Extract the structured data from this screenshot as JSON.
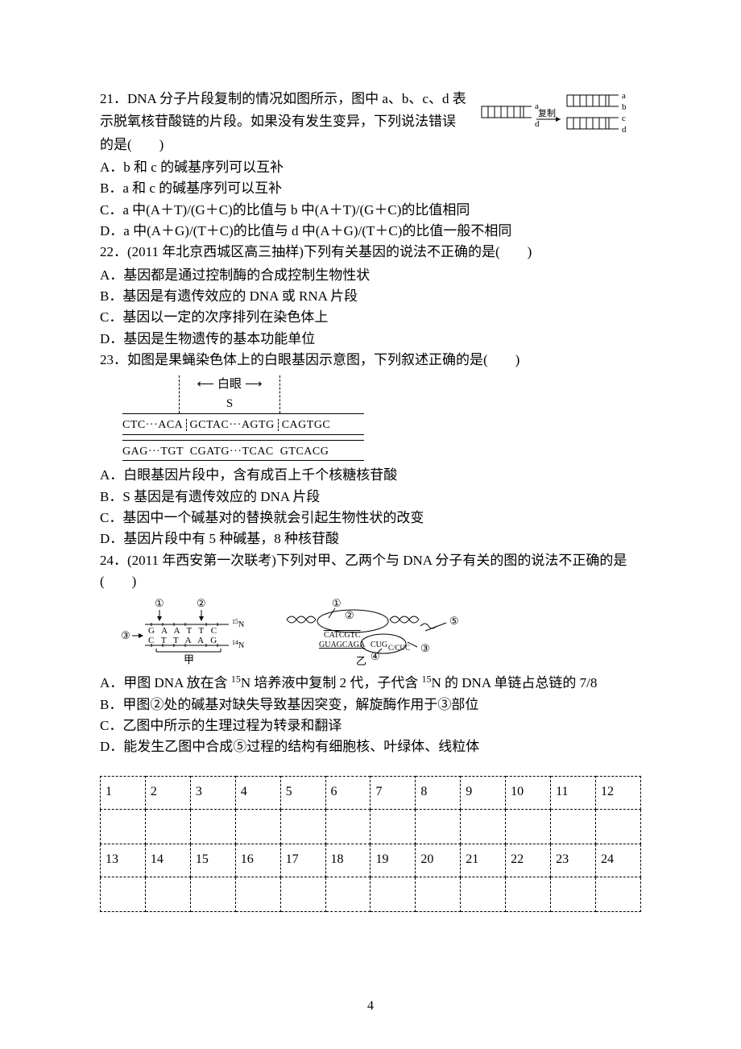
{
  "q21": {
    "stem1": "21．DNA 分子片段复制的情况如图所示，图中 a、b、c、d 表",
    "stem2": "示脱氧核苷酸链的片段。如果没有发生变异，下列说法错误",
    "stem3": "的是(　　)",
    "optA": "A．b 和 c 的碱基序列可以互补",
    "optB": "B．a 和 c 的碱基序列可以互补",
    "optC": "C．a 中(A＋T)/(G＋C)的比值与 b 中(A＋T)/(G＋C)的比值相同",
    "optD": "D．a 中(A＋G)/(T＋C)的比值与 d 中(A＋G)/(T＋C)的比值一般不相同",
    "fig": {
      "a": "a",
      "b": "b",
      "c": "c",
      "d": "d",
      "arrow": "复制"
    }
  },
  "q22": {
    "stem": "22．(2011 年北京西城区高三抽样)下列有关基因的说法不正确的是(　　)",
    "optA": "A．基因都是通过控制酶的合成控制生物性状",
    "optB": "B．基因是有遗传效应的 DNA 或 RNA 片段",
    "optC": "C．基因以一定的次序排列在染色体上",
    "optD": "D．基因是生物遗传的基本功能单位"
  },
  "q23": {
    "stem": "23．如图是果蝇染色体上的白眼基因示意图，下列叙述正确的是(　　)",
    "fig": {
      "top_label_left": "白眼",
      "top_label_right": "S",
      "seq_top_left": "CTC···ACA",
      "seq_top_mid": "GCTAC···AGTG",
      "seq_top_right": "CAGTGC",
      "seq_bot_left": "GAG···TGT",
      "seq_bot_mid": "CGATG···TCAC",
      "seq_bot_right": "GTCACG"
    },
    "optA": "A．白眼基因片段中，含有成百上千个核糖核苷酸",
    "optB": "B．S 基因是有遗传效应的 DNA 片段",
    "optC": "C．基因中一个碱基对的替换就会引起生物性状的改变",
    "optD": "D．基因片段中有 5 种碱基，8 种核苷酸"
  },
  "q24": {
    "stem": "24．(2011 年西安第一次联考)下列对甲、乙两个与 DNA 分子有关的图的说法不正确的是(　　)",
    "fig": {
      "jia": {
        "num1": "①",
        "num2": "②",
        "num3": "③",
        "n15": "15N",
        "n14": "14N",
        "top_seq": "G A A T T C",
        "bot_seq": "C T T A A G",
        "label": "甲"
      },
      "yi": {
        "num1": "①",
        "num2": "②",
        "num3": "③",
        "num4": "④",
        "num5": "⑤",
        "dna_top": "CATCGTC",
        "rna": "GUAGCAGA",
        "codon": "CUGC/CUC",
        "label": "乙"
      }
    },
    "optA_pre": "A．甲图 DNA 放在含 ",
    "optA_sup1": "15",
    "optA_mid": "N 培养液中复制 2 代，子代含 ",
    "optA_sup2": "15",
    "optA_post": "N 的 DNA 单链占总链的 7/8",
    "optB": "B．甲图②处的碱基对缺失导致基因突变，解旋酶作用于③部位",
    "optC": "C．乙图中所示的生理过程为转录和翻译",
    "optD": "D．能发生乙图中合成⑤过程的结构有细胞核、叶绿体、线粒体"
  },
  "table": {
    "row1": [
      "1",
      "2",
      "3",
      "4",
      "5",
      "6",
      "7",
      "8",
      "9",
      "10",
      "11",
      "12"
    ],
    "row2": [
      "13",
      "14",
      "15",
      "16",
      "17",
      "18",
      "19",
      "20",
      "21",
      "22",
      "23",
      "24"
    ]
  },
  "page_number": "4"
}
